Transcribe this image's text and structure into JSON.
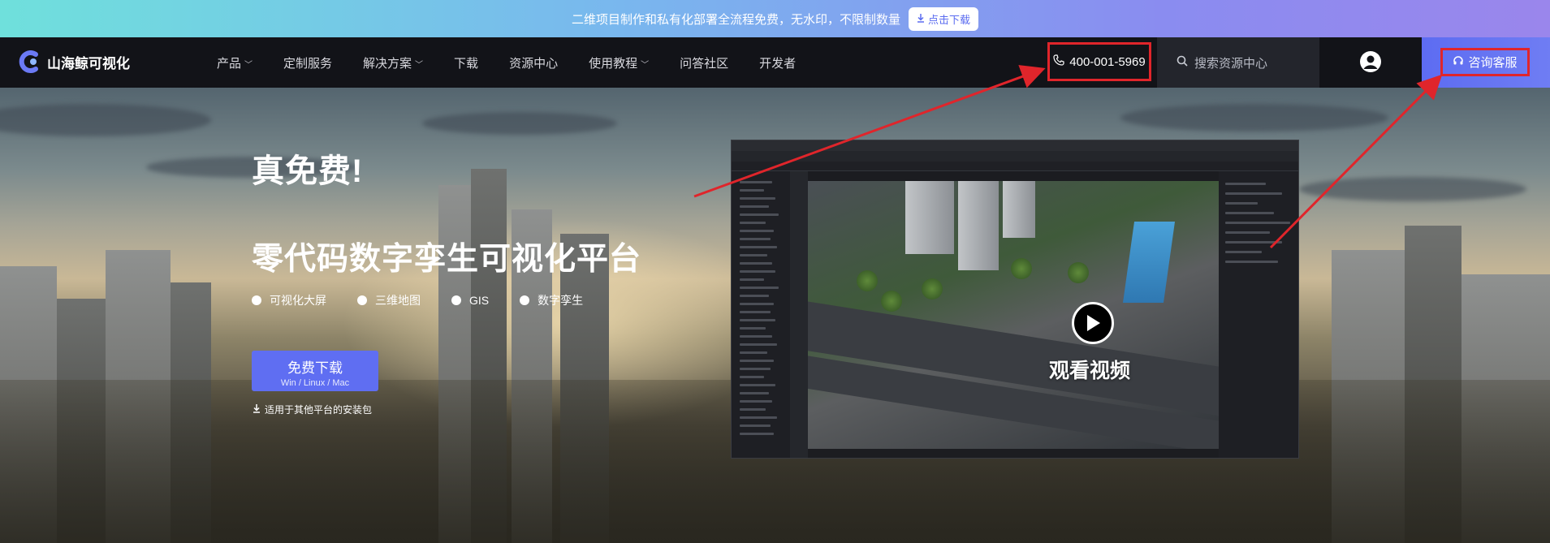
{
  "promo": {
    "text": "二维项目制作和私有化部署全流程免费，无水印，不限制数量",
    "button_label": "点击下载",
    "button_icon": "download-icon"
  },
  "nav": {
    "brand": "山海鲸可视化",
    "items": [
      {
        "label": "产品",
        "dropdown": true
      },
      {
        "label": "定制服务",
        "dropdown": false
      },
      {
        "label": "解决方案",
        "dropdown": true
      },
      {
        "label": "下载",
        "dropdown": false
      },
      {
        "label": "资源中心",
        "dropdown": false
      },
      {
        "label": "使用教程",
        "dropdown": true
      },
      {
        "label": "问答社区",
        "dropdown": false
      },
      {
        "label": "开发者",
        "dropdown": false
      }
    ],
    "phone": "400-001-5969",
    "search_placeholder": "搜索资源中心",
    "consult_label": "咨询客服"
  },
  "hero": {
    "headline": "真免费!",
    "subheadline": "零代码数字孪生可视化平台",
    "features": [
      "可视化大屏",
      "三维地图",
      "GIS",
      "数字孪生"
    ],
    "download_label": "免费下载",
    "download_platforms": "Win / Linux / Mac",
    "other_platforms_label": "适用于其他平台的安装包",
    "video_label": "观看视频"
  },
  "colors": {
    "accent": "#5f6ef2",
    "highlight_box": "#e0252b",
    "nav_bg": "#121318"
  }
}
